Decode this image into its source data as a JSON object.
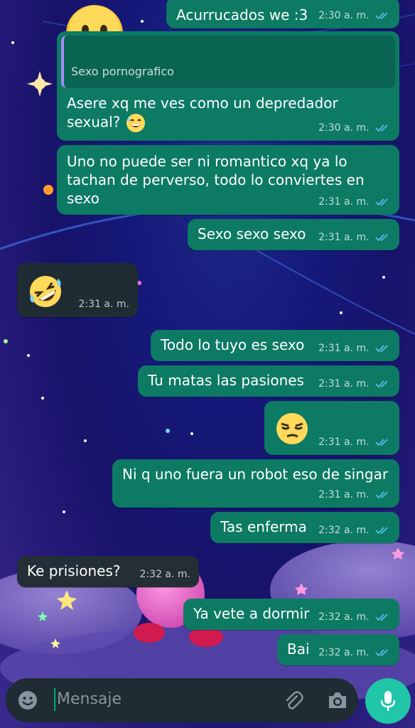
{
  "chat": {
    "messages": [
      {
        "id": "m1",
        "direction": "out",
        "text": "Acurrucados we :3",
        "time": "2:30 a. m.",
        "ticks": "read"
      },
      {
        "id": "m2",
        "direction": "out",
        "quote": "Sexo pornografico",
        "text": "Asere xq me ves como un depredador sexual?",
        "emoji": "sweat-smile-emoji",
        "time": "2:30 a. m.",
        "ticks": "read"
      },
      {
        "id": "m3",
        "direction": "out",
        "text": "Uno no puede ser ni romantico xq ya lo tachan de perverso, todo lo conviertes en sexo",
        "time": "2:31 a. m.",
        "ticks": "read"
      },
      {
        "id": "m4",
        "direction": "out",
        "text": "Sexo sexo sexo",
        "time": "2:31 a. m.",
        "ticks": "read"
      },
      {
        "id": "m5",
        "direction": "in",
        "emoji": "rolling-laughing-emoji",
        "time": "2:31 a. m."
      },
      {
        "id": "m6",
        "direction": "out",
        "text": "Todo lo tuyo es sexo",
        "time": "2:31 a. m.",
        "ticks": "read"
      },
      {
        "id": "m7",
        "direction": "out",
        "text": "Tu matas las pasiones",
        "time": "2:31 a. m.",
        "ticks": "read"
      },
      {
        "id": "m8",
        "direction": "out",
        "emoji": "unamused-face-emoji",
        "time": "2:31 a. m.",
        "ticks": "read"
      },
      {
        "id": "m9",
        "direction": "out",
        "text": "Ni q uno fuera un robot eso de singar",
        "time": "2:31 a. m.",
        "ticks": "read"
      },
      {
        "id": "m10",
        "direction": "out",
        "text": "Tas enferma",
        "time": "2:32 a. m.",
        "ticks": "read"
      },
      {
        "id": "m11",
        "direction": "in",
        "text": "Ke prisiones?",
        "time": "2:32 a. m."
      },
      {
        "id": "m12",
        "direction": "out",
        "text": "Ya vete a dormir",
        "time": "2:32 a. m.",
        "ticks": "read"
      },
      {
        "id": "m13",
        "direction": "out",
        "text": "Bai",
        "time": "2:32 a. m.",
        "ticks": "read"
      }
    ]
  },
  "composer": {
    "placeholder": "Mensaje",
    "icons": [
      "emoji-icon",
      "attach-icon",
      "camera-icon",
      "mic-icon"
    ]
  },
  "colors": {
    "outgoing_bubble": "#0d7a64",
    "incoming_bubble": "#1f2c33",
    "read_ticks": "#53bdeb",
    "mic_button": "#21c6a8"
  }
}
